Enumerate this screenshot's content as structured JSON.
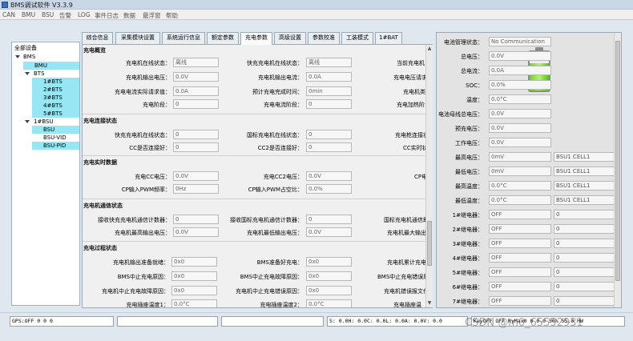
{
  "window": {
    "title": "BMS调试软件 V3.3.9"
  },
  "menu": [
    "CAN",
    "BMU",
    "BSU",
    "告警",
    "LOG",
    "事件日志",
    "数据",
    "最浮窗",
    "帮助"
  ],
  "tree": {
    "header": "全部设备",
    "items": [
      "BMS",
      "BMU",
      "BTS",
      "1#BTS",
      "2#BTS",
      "3#BTS",
      "4#BTS",
      "5#BTS",
      "1#BSU",
      "BSU",
      "BSU-VID",
      "BSU-PID"
    ]
  },
  "tabs": [
    "综合信息",
    "采集模块设置",
    "系统运行信息",
    "额定参数",
    "充电参数",
    "高级设置",
    "参数校准",
    "工装模式",
    "1#BAT"
  ],
  "sections": {
    "overview": {
      "title": "充电概览",
      "labels": [
        "充电机在线状态：",
        "快充充电机在线状态：",
        "当前充电机",
        "充电机输出电压：",
        "充电机输出电流：",
        "充电电压请求",
        "充电电流实际请求值：",
        "预计充电完成时间：",
        "充电机类",
        "充电阶段：",
        "充电电流阶段：",
        "充电加热阶"
      ],
      "values": [
        "离线",
        "离线",
        "0.0V",
        "0.0A",
        "0.0A",
        "0min",
        "0",
        "0"
      ]
    },
    "connect": {
      "title": "充电连接状态",
      "labels": [
        "快充充电机在线状态：",
        "国标充电机在线状态：",
        "充电枪连接状",
        "CC是否连接好：",
        "CC2是否连接好：",
        "CC实时状"
      ],
      "values": [
        "0",
        "0",
        "0",
        "0"
      ]
    },
    "realtime": {
      "title": "充电实时数据",
      "labels": [
        "充电CC电压：",
        "充电CC2电压：",
        "CP电",
        "CP输入PWM频率：",
        "CP输入PWM占空比："
      ],
      "values": [
        "0.0V",
        "0.0V",
        "0Hz",
        "0.0%"
      ]
    },
    "comm": {
      "title": "充电机通信状态",
      "labels": [
        "接收快充充电机通信计数器：",
        "接收国标充电机通信计数器：",
        "国标充电机通信助",
        "充电机最高输出电压：",
        "充电机最低输出电压：",
        "充电机最大输出电"
      ],
      "values": [
        "0",
        "0",
        "0.0V",
        "0.0V"
      ]
    },
    "process": {
      "title": "充电过程状态",
      "labels": [
        "充电机输出准备就绪：",
        "BMS准备好充电：",
        "充电机累计充电时",
        "BMS中止充电原因：",
        "BMS中止充电故障原因：",
        "BMS中止充电错误原",
        "充电机中止充电故障原因：",
        "充电机中止充电错误原因：",
        "充电机错误报文代",
        "充电插座温度1：",
        "充电插座温度2：",
        "充电插座温"
      ],
      "values": [
        "0x0",
        "0x0",
        "0x0",
        "0x0",
        "0x0",
        "0x0",
        "0.0°C",
        "0.0°C"
      ]
    }
  },
  "right_panel": {
    "rows": [
      {
        "label": "电池管理状态：",
        "value": "No Communication"
      },
      {
        "label": "总电压：",
        "value": "0.0V"
      },
      {
        "label": "总电流：",
        "value": "0.0A"
      },
      {
        "label": "SOC：",
        "value": "0.0%"
      },
      {
        "label": "温度：",
        "value": "0.0°C"
      },
      {
        "label": "电池母线总电压：",
        "value": "0.0V"
      },
      {
        "label": "预充电压：",
        "value": "0.0V"
      },
      {
        "label": "工作电压：",
        "value": "0.0V"
      },
      {
        "label": "最高电压：",
        "value": "0mV",
        "extra": "BSU1 CELL1"
      },
      {
        "label": "最低电压：",
        "value": "0mV",
        "extra": "BSU1 CELL1"
      },
      {
        "label": "最高温度：",
        "value": "0.0°C",
        "extra": "BSU1 CELL1"
      },
      {
        "label": "最低温度：",
        "value": "0.0°C",
        "extra": "BSU1 CELL1"
      },
      {
        "label": "1#继电器：",
        "value": "OFF",
        "extra": "0"
      },
      {
        "label": "2#继电器：",
        "value": "OFF",
        "extra": "0"
      },
      {
        "label": "3#继电器：",
        "value": "OFF",
        "extra": "0"
      },
      {
        "label": "4#继电器：",
        "value": "OFF",
        "extra": "0"
      },
      {
        "label": "5#继电器：",
        "value": "OFF",
        "extra": "0"
      },
      {
        "label": "6#继电器：",
        "value": "OFF",
        "extra": "0"
      },
      {
        "label": "7#继电器：",
        "value": "OFF",
        "extra": "0"
      }
    ],
    "soc_fraction": 0.7
  },
  "statusbar": {
    "gps": "GPS:OFF  0  0  0",
    "box2": "",
    "box3": "",
    "box4": "",
    "box5": "S:  0.0H:  0.0C:  0.0L:  0.0A:  0.0V:  0.0",
    "box6": "KeyOFF  OFF  RyMax0  0  0.0  50%  55.0  HW"
  },
  "watermark": "CSDN @m0_65552931",
  "colors": {
    "tree_selected": "#96e6f4",
    "battery_fill": "#6fcf2a",
    "title_bar": "#cad7e6"
  }
}
